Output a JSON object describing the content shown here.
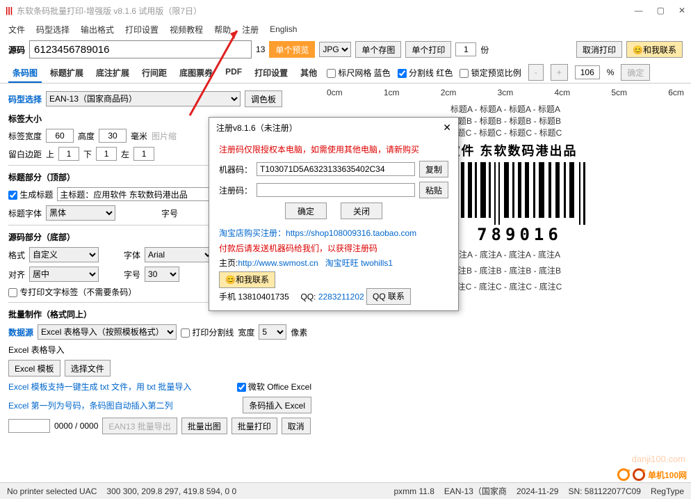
{
  "window": {
    "title": "东软条码批量打印-增强版 v8.1.6 试用版（限7日）"
  },
  "menu": {
    "file": "文件",
    "code": "码型选择",
    "output": "输出格式",
    "print": "打印设置",
    "video": "视频教程",
    "help": "帮助",
    "register": "注册",
    "english": "English"
  },
  "src": {
    "label": "源码",
    "value": "6123456789016",
    "count": "13",
    "preview": "单个预览",
    "format": "JPG",
    "save": "单个存图",
    "printOne": "单个打印",
    "copies": "1",
    "copiesUnit": "份",
    "cancel": "取消打印",
    "contact": "和我联系"
  },
  "tabs": {
    "barcode": "条码图",
    "titleExt": "标题扩展",
    "footExt": "底注扩展",
    "lineSpace": "行间距",
    "bgCoupon": "底图票券",
    "pdf": "PDF",
    "printSet": "打印设置",
    "other": "其他"
  },
  "preview": {
    "grid": "标尺网格 蓝色",
    "split": "分割线 红色",
    "lock": "锁定预览比例",
    "minus": "-",
    "plus": "+",
    "zoom": "106",
    "pct": "%",
    "confirm": "确定"
  },
  "ruler": {
    "r0": "0cm",
    "r1": "1cm",
    "r2": "2cm",
    "r3": "3cm",
    "r4": "4cm",
    "r5": "5cm",
    "r6": "6cm"
  },
  "codetype": {
    "label": "码型选择",
    "value": "EAN-13（国家商品码）",
    "palette": "调色板"
  },
  "size": {
    "title": "标签大小",
    "wLabel": "标签宽度",
    "w": "60",
    "hLabel": "高度",
    "h": "30",
    "unit": "毫米",
    "imgZoom": "图片缩",
    "mTitle": "留白边距",
    "top": "上",
    "topV": "1",
    "bottom": "下",
    "bottomV": "1",
    "left": "左",
    "leftV": "1"
  },
  "titleSec": {
    "header": "标题部分（顶部）",
    "gen": "生成标题",
    "main": "主标题：应用软件 东软数码港出品",
    "fontLabel": "标题字体",
    "font": "黑体",
    "sizeLabel": "字号"
  },
  "srcSec": {
    "header": "源码部分（底部）",
    "fmtLabel": "格式",
    "fmt": "自定义",
    "fontLabel": "字体",
    "font": "Arial",
    "alignLabel": "对齐",
    "align": "居中",
    "sizeLabel": "字号",
    "size": "30",
    "textOnly": "专打印文字标签（不需要条码）"
  },
  "batch": {
    "header": "批量制作（格式同上）",
    "dsLabel": "数据源",
    "ds": "Excel 表格导入（按照模板格式）",
    "splitLine": "打印分割线",
    "widthLabel": "宽度",
    "width": "5",
    "px": "像素",
    "excelImport": "Excel 表格导入",
    "tplBtn": "Excel 模板",
    "chooseBtn": "选择文件",
    "hint1": "Excel 模板支持一键生成 txt 文件，用 txt 批量导入",
    "hint2": "Excel 第一列为号码，条码图自动插入第二列",
    "ms": "微软 Office Excel",
    "insert": "条码插入 Excel",
    "counter": "0000 / 0000",
    "export": "EAN13 批量导出",
    "outImg": "批量出图",
    "outPrint": "批量打印",
    "cancel": "取消"
  },
  "dialog": {
    "title": "注册v8.1.6（未注册）",
    "hint": "注册码仅限授权本电脑，如需使用其他电脑，请新购买",
    "machineLabel": "机器码：",
    "machine": "T103071D5A6323133635402C34",
    "copy": "复制",
    "regLabel": "注册码：",
    "paste": "粘贴",
    "ok": "确定",
    "close": "关闭",
    "shopPrefix": "淘宝店购买注册：",
    "shop": "https://shop108009316.taobao.com",
    "payHint": "付款后请发送机器码给我们，以获得注册码",
    "siteLabel": "主页:",
    "site": "http://www.swmost.cn",
    "ww": "淘宝旺旺 twohills1",
    "contact": "和我联系",
    "phoneLabel": "手机",
    "phone": "13810401735",
    "qqLabel": "QQ:",
    "qq": "2283211202",
    "qqBtn": "QQ 联系"
  },
  "bc": {
    "titleA": "标题A",
    "titleB": "标题B",
    "titleC": "标题C",
    "appLine": "用软件  东软数码港出品",
    "digits": "6    789016",
    "footA": "底注A",
    "footB": "底注B",
    "footC": "底注C"
  },
  "status": {
    "printer": "No printer selected  UAC",
    "dims": "300 300, 209.8 297, 419.8 594, 0 0",
    "pxmm": "pxmm  11.8",
    "ean": "EAN-13（国家商",
    "date": "2024-11-29",
    "sn": "SN: 581122077C09",
    "reg": "RegType"
  },
  "brand": {
    "name": "单机100网",
    "wm": "danji100.com"
  }
}
